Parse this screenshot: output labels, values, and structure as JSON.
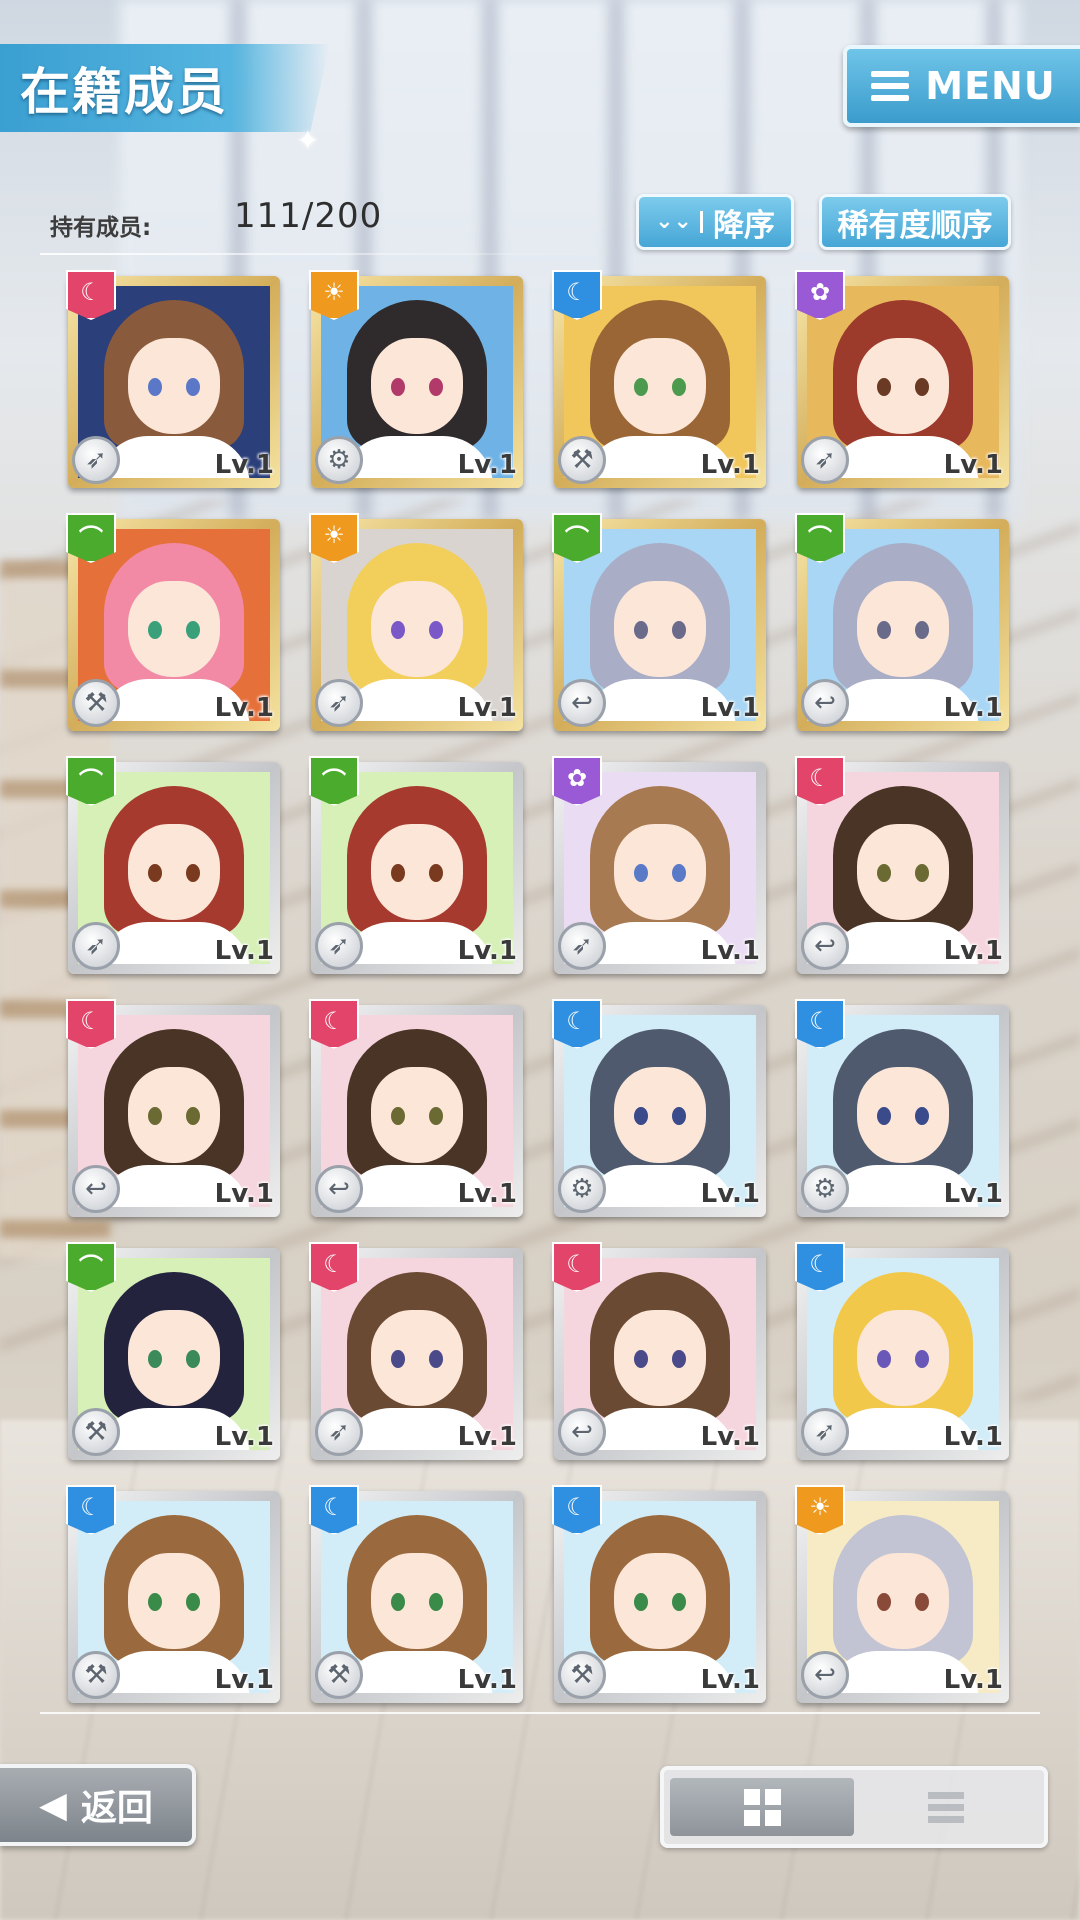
{
  "header": {
    "title": "在籍成员",
    "menu_label": "MENU"
  },
  "summary": {
    "label": "持有成员:",
    "value": "111/200"
  },
  "sort": {
    "order_label": "降序",
    "rarity_label": "稀有度顺序"
  },
  "colors": {
    "accent": "#46a6d6",
    "attr_pink": "#e2446a",
    "attr_orange": "#ef9a1e",
    "attr_blue": "#2f8fe0",
    "attr_purple": "#9a5ad6",
    "attr_green": "#4bab2c"
  },
  "members": [
    {
      "level": "Lv.1",
      "frame": "gold",
      "attr": "pink",
      "role_icon": "wand-icon",
      "hair": "#8a5a3c",
      "eye": "#5b78c8",
      "bg": "#2b3f7a"
    },
    {
      "level": "Lv.1",
      "frame": "gold",
      "attr": "orange",
      "role_icon": "gear-icon",
      "hair": "#2f2a2c",
      "eye": "#b23a6a",
      "bg": "#6fb3e6"
    },
    {
      "level": "Lv.1",
      "frame": "gold",
      "attr": "blue",
      "role_icon": "hammer-icon",
      "hair": "#9a6636",
      "eye": "#4b9a4e",
      "bg": "#f1c65a"
    },
    {
      "level": "Lv.1",
      "frame": "gold",
      "attr": "purple",
      "role_icon": "wand-icon",
      "hair": "#9c3a2c",
      "eye": "#6a3a24",
      "bg": "#e8b85c"
    },
    {
      "level": "Lv.1",
      "frame": "gold",
      "attr": "green",
      "role_icon": "hammer-icon",
      "hair": "#f28aa6",
      "eye": "#3aa07a",
      "bg": "#e6703a"
    },
    {
      "level": "Lv.1",
      "frame": "gold",
      "attr": "orange",
      "role_icon": "wand-icon",
      "hair": "#f2cf5a",
      "eye": "#7a58c8",
      "bg": "#d9d4cf"
    },
    {
      "level": "Lv.1",
      "frame": "gold",
      "attr": "green",
      "role_icon": "hook-icon",
      "hair": "#a9adc6",
      "eye": "#6a6a8a",
      "bg": "#a8d6f4"
    },
    {
      "level": "Lv.1",
      "frame": "gold",
      "attr": "green",
      "role_icon": "hook-icon",
      "hair": "#a9adc6",
      "eye": "#6a6a8a",
      "bg": "#a8d6f4"
    },
    {
      "level": "Lv.1",
      "frame": "silver",
      "attr": "green",
      "role_icon": "wand-icon",
      "hair": "#a63a2e",
      "eye": "#7a3a20",
      "bg": "#d6f0b8"
    },
    {
      "level": "Lv.1",
      "frame": "silver",
      "attr": "green",
      "role_icon": "wand-icon",
      "hair": "#a63a2e",
      "eye": "#7a3a20",
      "bg": "#d6f0b8"
    },
    {
      "level": "Lv.1",
      "frame": "silver",
      "attr": "purple",
      "role_icon": "wand-icon",
      "hair": "#a87a52",
      "eye": "#5a7ac8",
      "bg": "#eadcf2"
    },
    {
      "level": "Lv.1",
      "frame": "silver",
      "attr": "pink",
      "role_icon": "hook-icon",
      "hair": "#4a3426",
      "eye": "#6a6a32",
      "bg": "#f6d6de"
    },
    {
      "level": "Lv.1",
      "frame": "silver",
      "attr": "pink",
      "role_icon": "hook-icon",
      "hair": "#4a3426",
      "eye": "#6a6a32",
      "bg": "#f6d6de"
    },
    {
      "level": "Lv.1",
      "frame": "silver",
      "attr": "pink",
      "role_icon": "hook-icon",
      "hair": "#4a3426",
      "eye": "#6a6a32",
      "bg": "#f6d6de"
    },
    {
      "level": "Lv.1",
      "frame": "silver",
      "attr": "blue",
      "role_icon": "gear-icon",
      "hair": "#4f5a6e",
      "eye": "#3a4a8a",
      "bg": "#d2ecf8"
    },
    {
      "level": "Lv.1",
      "frame": "silver",
      "attr": "blue",
      "role_icon": "gear-icon",
      "hair": "#4f5a6e",
      "eye": "#3a4a8a",
      "bg": "#d2ecf8"
    },
    {
      "level": "Lv.1",
      "frame": "silver",
      "attr": "green",
      "role_icon": "hammer-icon",
      "hair": "#23233e",
      "eye": "#3a8a5a",
      "bg": "#d6f0b8"
    },
    {
      "level": "Lv.1",
      "frame": "silver",
      "attr": "pink",
      "role_icon": "wand-icon",
      "hair": "#6a4a32",
      "eye": "#4a4a8a",
      "bg": "#f6d6de"
    },
    {
      "level": "Lv.1",
      "frame": "silver",
      "attr": "pink",
      "role_icon": "hook-icon",
      "hair": "#6a4a32",
      "eye": "#4a4a8a",
      "bg": "#f6d6de"
    },
    {
      "level": "Lv.1",
      "frame": "silver",
      "attr": "blue",
      "role_icon": "wand-icon",
      "hair": "#f2c84a",
      "eye": "#6a58b8",
      "bg": "#d2ecf8"
    },
    {
      "level": "Lv.1",
      "frame": "silver",
      "attr": "blue",
      "role_icon": "hammer-icon",
      "hair": "#9a6a3e",
      "eye": "#3a8a4a",
      "bg": "#d2ecf8"
    },
    {
      "level": "Lv.1",
      "frame": "silver",
      "attr": "blue",
      "role_icon": "hammer-icon",
      "hair": "#9a6a3e",
      "eye": "#3a8a4a",
      "bg": "#d2ecf8"
    },
    {
      "level": "Lv.1",
      "frame": "silver",
      "attr": "blue",
      "role_icon": "hammer-icon",
      "hair": "#9a6a3e",
      "eye": "#3a8a4a",
      "bg": "#d2ecf8"
    },
    {
      "level": "Lv.1",
      "frame": "silver",
      "attr": "orange",
      "role_icon": "hook-icon",
      "hair": "#c2c4d4",
      "eye": "#8a4a3a",
      "bg": "#f6ebc4"
    }
  ],
  "footer": {
    "back_label": "返回",
    "view_mode": "grid"
  }
}
